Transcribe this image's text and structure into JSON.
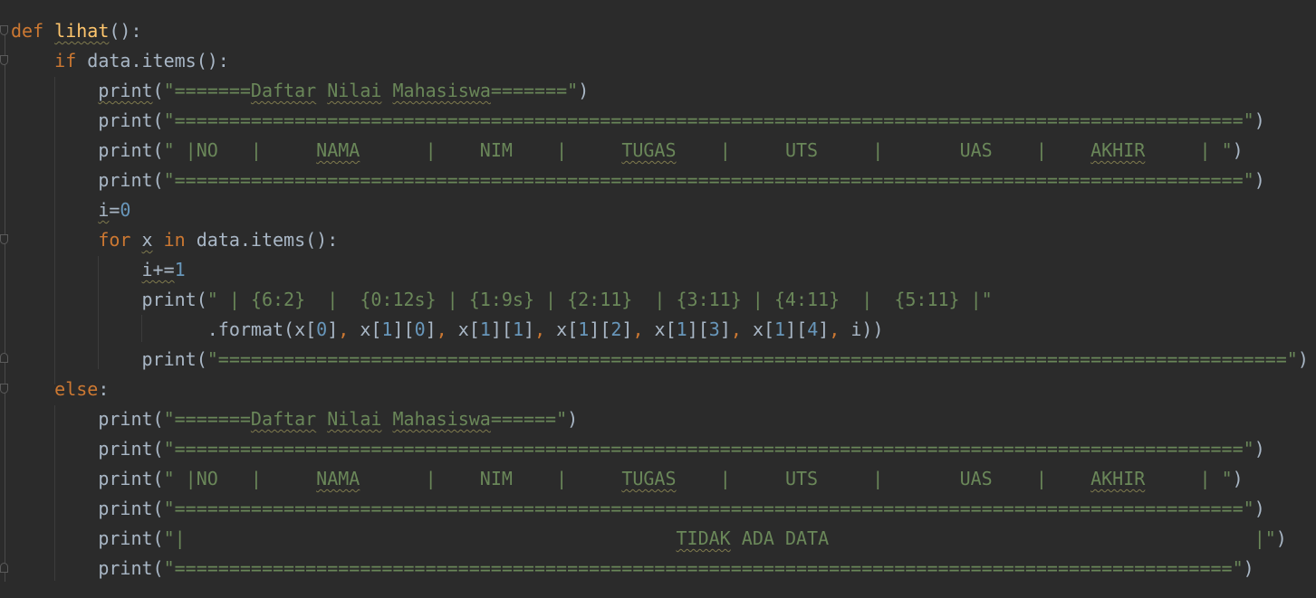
{
  "editor": {
    "language": "python",
    "theme_colors": {
      "background": "#2b2b2b",
      "keyword": "#cc7832",
      "function": "#ffc66d",
      "string": "#6a8759",
      "number": "#6897bb",
      "text": "#a9b7c6"
    },
    "lines": [
      {
        "tokens": [
          {
            "t": "def",
            "c": "kw"
          },
          {
            "t": " ",
            "c": "plain"
          },
          {
            "t": "lihat",
            "c": "fn sq"
          },
          {
            "t": "():",
            "c": "plain"
          }
        ]
      },
      {
        "tokens": [
          {
            "t": "    ",
            "c": "plain"
          },
          {
            "t": "if",
            "c": "kw"
          },
          {
            "t": " data.items():",
            "c": "plain"
          }
        ]
      },
      {
        "tokens": [
          {
            "t": "        ",
            "c": "plain"
          },
          {
            "t": "print",
            "c": "plain sq"
          },
          {
            "t": "(",
            "c": "plain"
          },
          {
            "t": "\"=======",
            "c": "str"
          },
          {
            "t": "Daftar",
            "c": "str sq"
          },
          {
            "t": " ",
            "c": "str"
          },
          {
            "t": "Nilai",
            "c": "str sq"
          },
          {
            "t": " ",
            "c": "str"
          },
          {
            "t": "Mahasiswa",
            "c": "str sq"
          },
          {
            "t": "=======\"",
            "c": "str"
          },
          {
            "t": ")",
            "c": "plain"
          }
        ]
      },
      {
        "tokens": [
          {
            "t": "        print(",
            "c": "plain"
          },
          {
            "t": "\"==================================================================================================\"",
            "c": "str"
          },
          {
            "t": ")",
            "c": "plain"
          }
        ]
      },
      {
        "tokens": [
          {
            "t": "        print(",
            "c": "plain"
          },
          {
            "t": "\" |NO   |     ",
            "c": "str"
          },
          {
            "t": "NAMA",
            "c": "str sq"
          },
          {
            "t": "      |    NIM    |     ",
            "c": "str"
          },
          {
            "t": "TUGAS",
            "c": "str sq"
          },
          {
            "t": "    |     UTS     |       UAS    |    ",
            "c": "str"
          },
          {
            "t": "AKHIR",
            "c": "str sq"
          },
          {
            "t": "     | \"",
            "c": "str"
          },
          {
            "t": ")",
            "c": "plain"
          }
        ]
      },
      {
        "tokens": [
          {
            "t": "        print(",
            "c": "plain"
          },
          {
            "t": "\"==================================================================================================\"",
            "c": "str"
          },
          {
            "t": ")",
            "c": "plain"
          }
        ]
      },
      {
        "tokens": [
          {
            "t": "        ",
            "c": "plain"
          },
          {
            "t": "i",
            "c": "plain sq"
          },
          {
            "t": "=",
            "c": "plain"
          },
          {
            "t": "0",
            "c": "num"
          }
        ]
      },
      {
        "tokens": [
          {
            "t": "        ",
            "c": "plain"
          },
          {
            "t": "for",
            "c": "kw"
          },
          {
            "t": " ",
            "c": "plain"
          },
          {
            "t": "x",
            "c": "plain sq"
          },
          {
            "t": " ",
            "c": "plain"
          },
          {
            "t": "in",
            "c": "kw"
          },
          {
            "t": " data.items():",
            "c": "plain"
          }
        ]
      },
      {
        "tokens": [
          {
            "t": "            ",
            "c": "plain"
          },
          {
            "t": "i+=",
            "c": "plain sq"
          },
          {
            "t": "1",
            "c": "num"
          }
        ]
      },
      {
        "tokens": [
          {
            "t": "            print(",
            "c": "plain"
          },
          {
            "t": "\" | {6:2}  |  {0:12s} | {1:9s} | {2:11}  | {3:11} | {4:11}  |  {5:11} |\"",
            "c": "str"
          }
        ]
      },
      {
        "tokens": [
          {
            "t": "                  .format(x[",
            "c": "plain"
          },
          {
            "t": "0",
            "c": "num"
          },
          {
            "t": "]",
            "c": "plain"
          },
          {
            "t": ",",
            "c": "punc"
          },
          {
            "t": " x[",
            "c": "plain"
          },
          {
            "t": "1",
            "c": "num"
          },
          {
            "t": "][",
            "c": "plain"
          },
          {
            "t": "0",
            "c": "num"
          },
          {
            "t": "]",
            "c": "plain"
          },
          {
            "t": ",",
            "c": "punc"
          },
          {
            "t": " x[",
            "c": "plain"
          },
          {
            "t": "1",
            "c": "num"
          },
          {
            "t": "][",
            "c": "plain"
          },
          {
            "t": "1",
            "c": "num"
          },
          {
            "t": "]",
            "c": "plain"
          },
          {
            "t": ",",
            "c": "punc"
          },
          {
            "t": " x[",
            "c": "plain"
          },
          {
            "t": "1",
            "c": "num"
          },
          {
            "t": "][",
            "c": "plain"
          },
          {
            "t": "2",
            "c": "num"
          },
          {
            "t": "]",
            "c": "plain"
          },
          {
            "t": ",",
            "c": "punc"
          },
          {
            "t": " x[",
            "c": "plain"
          },
          {
            "t": "1",
            "c": "num"
          },
          {
            "t": "][",
            "c": "plain"
          },
          {
            "t": "3",
            "c": "num"
          },
          {
            "t": "]",
            "c": "plain"
          },
          {
            "t": ",",
            "c": "punc"
          },
          {
            "t": " x[",
            "c": "plain"
          },
          {
            "t": "1",
            "c": "num"
          },
          {
            "t": "][",
            "c": "plain"
          },
          {
            "t": "4",
            "c": "num"
          },
          {
            "t": "]",
            "c": "plain"
          },
          {
            "t": ",",
            "c": "punc"
          },
          {
            "t": " i))",
            "c": "plain"
          }
        ]
      },
      {
        "tokens": [
          {
            "t": "            print(",
            "c": "plain"
          },
          {
            "t": "\"==================================================================================================\"",
            "c": "str"
          },
          {
            "t": ")",
            "c": "plain"
          }
        ]
      },
      {
        "tokens": [
          {
            "t": "    ",
            "c": "plain"
          },
          {
            "t": "else",
            "c": "kw"
          },
          {
            "t": ":",
            "c": "plain"
          }
        ]
      },
      {
        "tokens": [
          {
            "t": "        print(",
            "c": "plain"
          },
          {
            "t": "\"=======",
            "c": "str"
          },
          {
            "t": "Daftar",
            "c": "str sq"
          },
          {
            "t": " ",
            "c": "str"
          },
          {
            "t": "Nilai",
            "c": "str sq"
          },
          {
            "t": " ",
            "c": "str"
          },
          {
            "t": "Mahasiswa",
            "c": "str sq"
          },
          {
            "t": "======\"",
            "c": "str"
          },
          {
            "t": ")",
            "c": "plain"
          }
        ]
      },
      {
        "tokens": [
          {
            "t": "        print(",
            "c": "plain"
          },
          {
            "t": "\"==================================================================================================\"",
            "c": "str"
          },
          {
            "t": ")",
            "c": "plain"
          }
        ]
      },
      {
        "tokens": [
          {
            "t": "        print(",
            "c": "plain"
          },
          {
            "t": "\" |NO   |     ",
            "c": "str"
          },
          {
            "t": "NAMA",
            "c": "str sq"
          },
          {
            "t": "      |    NIM    |     ",
            "c": "str"
          },
          {
            "t": "TUGAS",
            "c": "str sq"
          },
          {
            "t": "    |     UTS     |       UAS    |    ",
            "c": "str"
          },
          {
            "t": "AKHIR",
            "c": "str sq"
          },
          {
            "t": "     | \"",
            "c": "str"
          },
          {
            "t": ")",
            "c": "plain"
          }
        ]
      },
      {
        "tokens": [
          {
            "t": "        print(",
            "c": "plain"
          },
          {
            "t": "\"==================================================================================================\"",
            "c": "str"
          },
          {
            "t": ")",
            "c": "plain"
          }
        ]
      },
      {
        "tokens": [
          {
            "t": "        print(",
            "c": "plain"
          },
          {
            "t": "\"|                                             ",
            "c": "str"
          },
          {
            "t": "TIDAK",
            "c": "str sq"
          },
          {
            "t": " ADA DATA                                       |\"",
            "c": "str"
          },
          {
            "t": ")",
            "c": "plain"
          }
        ]
      },
      {
        "tokens": [
          {
            "t": "        print(",
            "c": "plain"
          },
          {
            "t": "\"=================================================================================================\"",
            "c": "str"
          },
          {
            "t": ")",
            "c": "plain"
          }
        ]
      }
    ]
  }
}
